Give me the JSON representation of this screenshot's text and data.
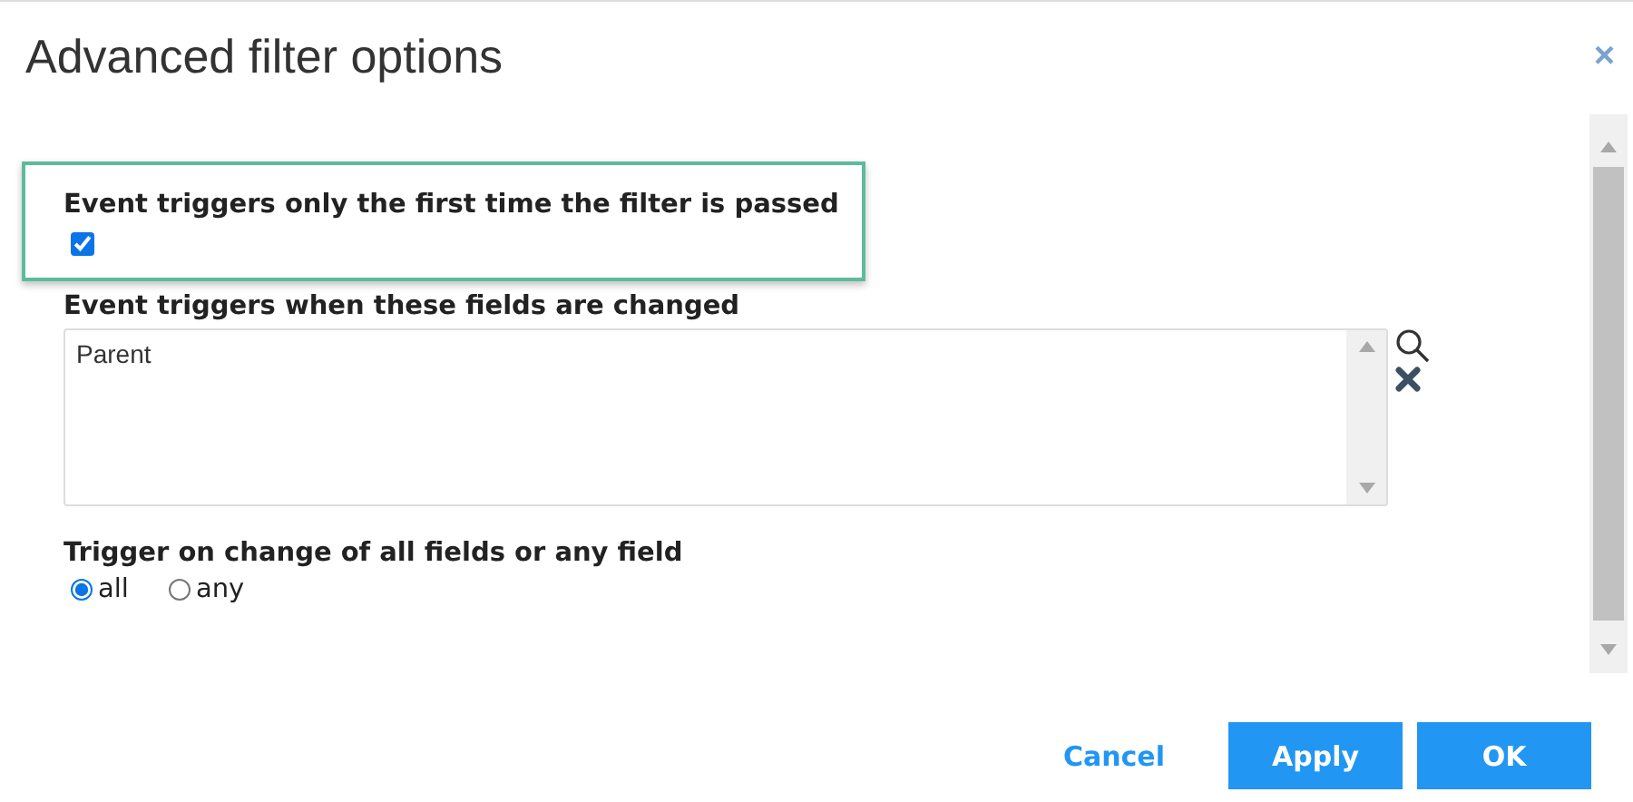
{
  "dialog": {
    "title": "Advanced filter options",
    "close": "×"
  },
  "first_time": {
    "label": "Event triggers only the first time the filter is passed",
    "checked": true,
    "highlighted": true
  },
  "fields": {
    "label": "Event triggers when these fields are changed",
    "value": "Parent"
  },
  "trigger_mode": {
    "label": "Trigger on change of all fields or any field",
    "options": [
      {
        "label": "all",
        "selected": true
      },
      {
        "label": "any",
        "selected": false
      }
    ]
  },
  "buttons": [
    {
      "label": "Cancel",
      "kind": "link"
    },
    {
      "label": "Apply",
      "kind": "primary"
    },
    {
      "label": "OK",
      "kind": "primary"
    }
  ]
}
